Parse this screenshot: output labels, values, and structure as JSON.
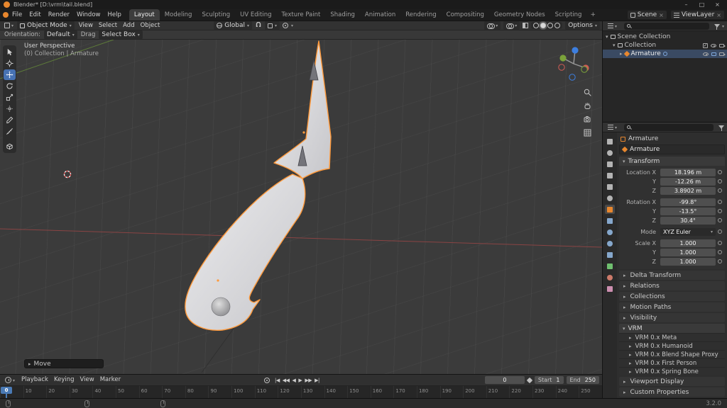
{
  "icons": {
    "chevron_collapsed": "▸",
    "chevron_expanded": "▾",
    "dropdown_arrow": "▾"
  },
  "titlebar": {
    "title": "Blender*  [D:\\vrm\\tail.blend]",
    "minimize": "–",
    "maximize": "□",
    "close": "×"
  },
  "topbar": {
    "menus": [
      "File",
      "Edit",
      "Render",
      "Window",
      "Help"
    ],
    "workspaces": [
      "Layout",
      "Modeling",
      "Sculpting",
      "UV Editing",
      "Texture Paint",
      "Shading",
      "Animation",
      "Rendering",
      "Compositing",
      "Geometry Nodes",
      "Scripting"
    ],
    "active_workspace": "Layout",
    "add_workspace": "+",
    "scene": "Scene",
    "view_layer": "ViewLayer"
  },
  "viewport_header": {
    "mode": "Object Mode",
    "menus": [
      "View",
      "Select",
      "Add",
      "Object"
    ],
    "orientation": "Global",
    "options": "Options"
  },
  "tool_settings": {
    "orientation_label": "Orientation:",
    "orientation_value": "Default",
    "drag_label": "Drag",
    "drag_value": "Select Box"
  },
  "toolbar": {
    "active_tool": "move",
    "tools": [
      "select-box",
      "cursor",
      "move",
      "rotate",
      "scale",
      "transform",
      "annotate",
      "measure",
      "add-cube"
    ]
  },
  "viewport": {
    "overlay_title": "User Perspective",
    "overlay_subtitle": "(0) Collection | Armature",
    "operator_label": "Move"
  },
  "outliner": {
    "rows": [
      {
        "label": "Scene Collection"
      },
      {
        "label": "Collection"
      },
      {
        "label": "Armature"
      }
    ]
  },
  "properties": {
    "tabs": [
      "tool",
      "render",
      "output",
      "view-layer",
      "scene",
      "world",
      "object",
      "modifiers",
      "particles",
      "physics",
      "constraints",
      "data",
      "material",
      "texture"
    ],
    "active_tab": "object",
    "breadcrumb": "Armature",
    "name": "Armature",
    "panels": {
      "transform_title": "Transform",
      "rows": [
        {
          "label": "Location X",
          "value": "18.196 m"
        },
        {
          "label": "Y",
          "value": "-12.26 m"
        },
        {
          "label": "Z",
          "value": "3.8902 m"
        },
        {
          "label": "Rotation X",
          "value": "-99.8°"
        },
        {
          "label": "Y",
          "value": "-13.5°"
        },
        {
          "label": "Z",
          "value": "30.4°"
        }
      ],
      "mode_label": "Mode",
      "mode_value": "XYZ Euler",
      "scale_rows": [
        {
          "label": "Scale X",
          "value": "1.000"
        },
        {
          "label": "Y",
          "value": "1.000"
        },
        {
          "label": "Z",
          "value": "1.000"
        }
      ],
      "collapsed": [
        "Delta Transform",
        "Relations",
        "Collections",
        "Motion Paths",
        "Visibility"
      ],
      "vrm_title": "VRM",
      "vrm_items": [
        "VRM 0.x Meta",
        "VRM 0.x Humanoid",
        "VRM 0.x Blend Shape Proxy",
        "VRM 0.x First Person",
        "VRM 0.x Spring Bone"
      ],
      "collapsed_bottom": [
        "Viewport Display",
        "Custom Properties"
      ]
    }
  },
  "timeline": {
    "menus": [
      "Playback",
      "Keying",
      "View",
      "Marker"
    ],
    "transport": [
      {
        "name": "jump-to-start",
        "glyph": "|◀"
      },
      {
        "name": "prev-keyframe",
        "glyph": "◀◀"
      },
      {
        "name": "play-reverse",
        "glyph": "◀"
      },
      {
        "name": "play",
        "glyph": "▶"
      },
      {
        "name": "next-keyframe",
        "glyph": "▶▶"
      },
      {
        "name": "jump-to-end",
        "glyph": "▶|"
      }
    ],
    "playhead": "0",
    "current_frame": "0",
    "start_label": "Start",
    "start_value": "1",
    "end_label": "End",
    "end_value": "250",
    "ticks": [
      "0",
      "10",
      "20",
      "30",
      "40",
      "50",
      "60",
      "70",
      "80",
      "90",
      "100",
      "110",
      "120",
      "130",
      "140",
      "150",
      "160",
      "170",
      "180",
      "190",
      "200",
      "210",
      "220",
      "230",
      "240",
      "250"
    ]
  },
  "statusbar": {
    "version": "3.2.0"
  },
  "colors": {
    "accent": "#4772b3",
    "selection_outline": "#ff9a3c",
    "header": "#323232",
    "viewport_bg": "#3b3b3b"
  }
}
